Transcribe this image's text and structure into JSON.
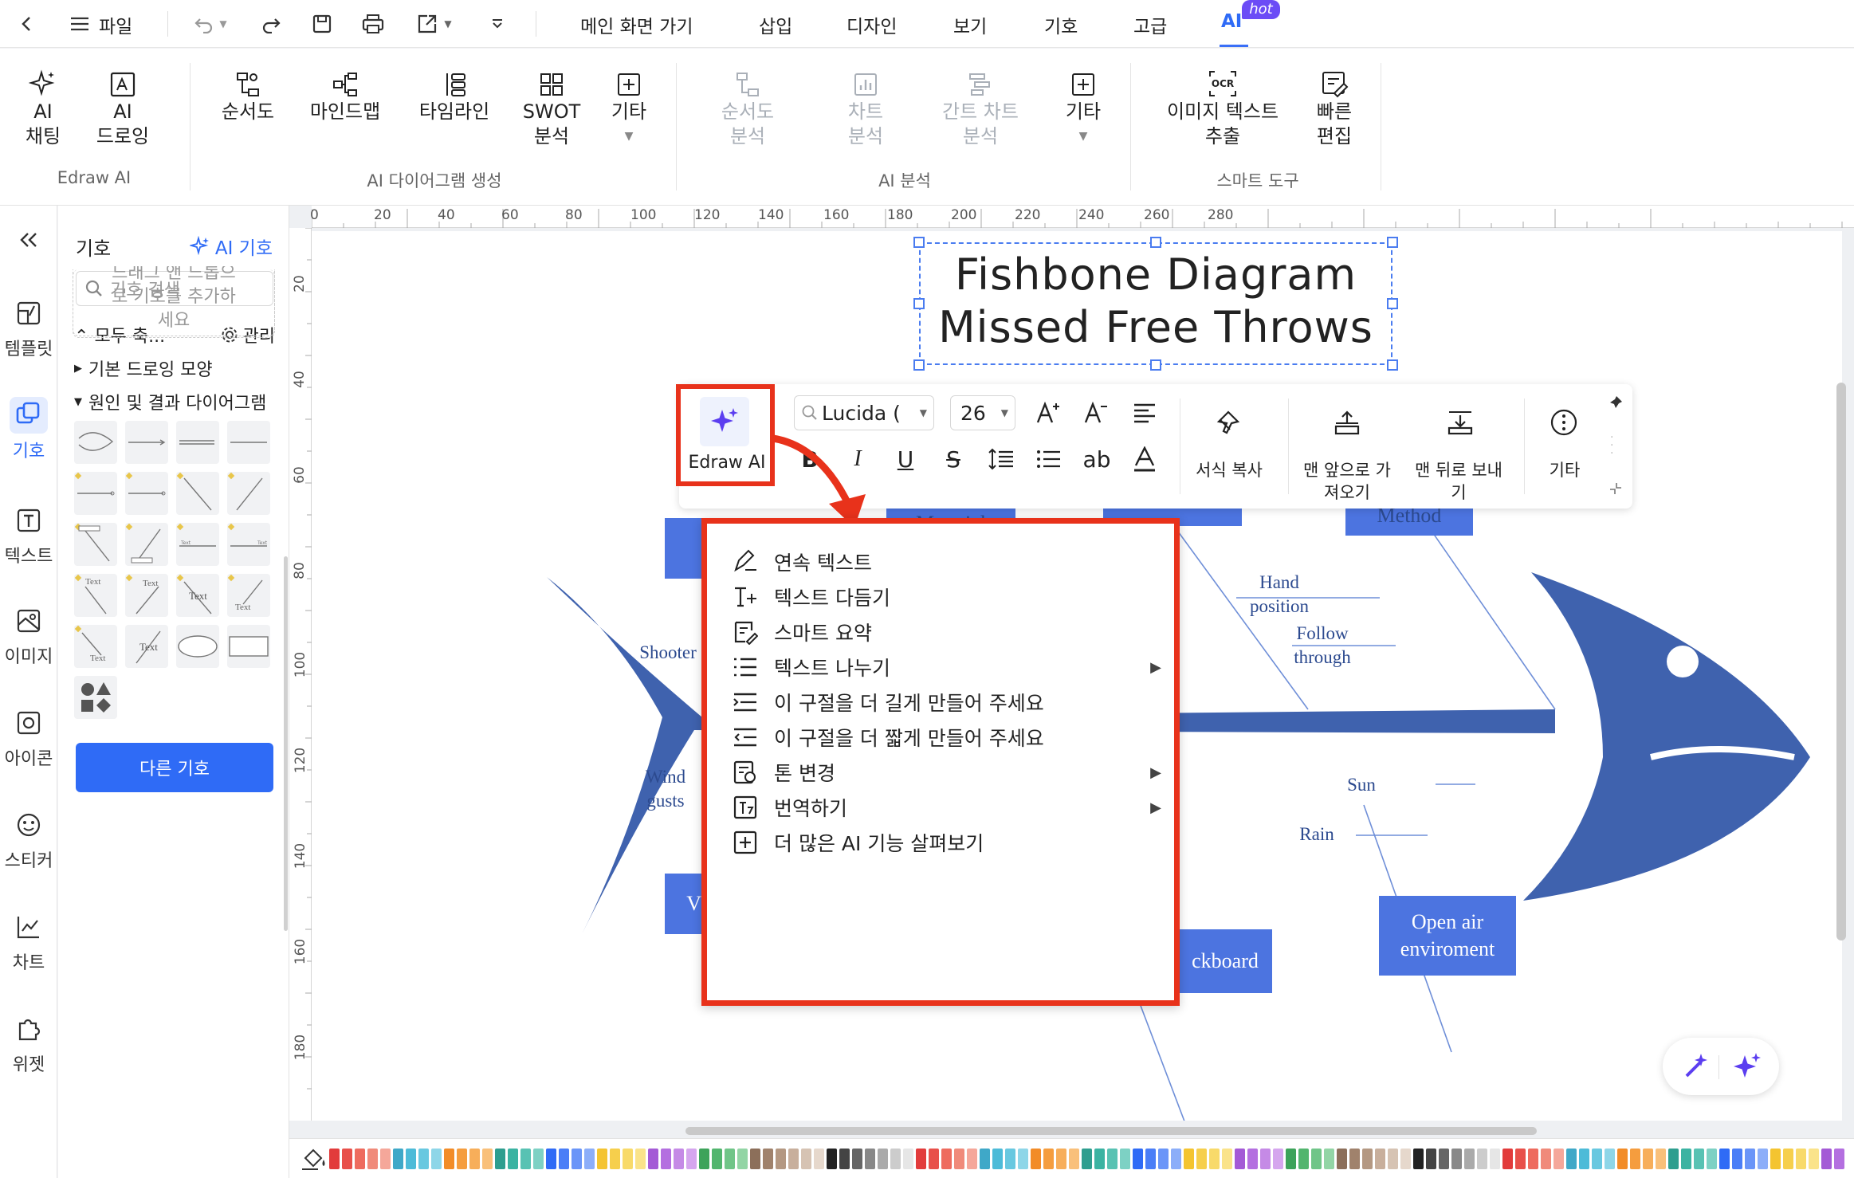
{
  "topbar": {
    "file_label": "파일",
    "menus": [
      {
        "label": "메인 화면 가기"
      },
      {
        "label": "삽입"
      },
      {
        "label": "디자인"
      },
      {
        "label": "보기"
      },
      {
        "label": "기호"
      },
      {
        "label": "고급"
      },
      {
        "label": "AI"
      }
    ],
    "hot_badge": "hot"
  },
  "ribbon": {
    "groups": [
      {
        "label": "Edraw AI"
      },
      {
        "label": "AI 다이어그램 생성"
      },
      {
        "label": "AI 분석"
      },
      {
        "label": "스마트 도구"
      }
    ],
    "buttons": [
      {
        "line1": "AI",
        "line2": "채팅"
      },
      {
        "line1": "AI",
        "line2": "드로잉"
      },
      {
        "line1": "순서도",
        "line2": ""
      },
      {
        "line1": "마인드맵",
        "line2": ""
      },
      {
        "line1": "타임라인",
        "line2": ""
      },
      {
        "line1": "SWOT",
        "line2": "분석"
      },
      {
        "line1": "기타",
        "line2": ""
      },
      {
        "line1": "순서도",
        "line2": "분석"
      },
      {
        "line1": "차트",
        "line2": "분석"
      },
      {
        "line1": "간트 차트",
        "line2": "분석"
      },
      {
        "line1": "기타",
        "line2": ""
      },
      {
        "line1": "이미지 텍스트",
        "line2": "추출"
      },
      {
        "line1": "빠른",
        "line2": "편집"
      }
    ]
  },
  "rail": {
    "items": [
      {
        "label": "템플릿"
      },
      {
        "label": "기호"
      },
      {
        "label": "텍스트"
      },
      {
        "label": "이미지"
      },
      {
        "label": "아이콘"
      },
      {
        "label": "스티커"
      },
      {
        "label": "차트"
      },
      {
        "label": "위젯"
      }
    ]
  },
  "panel": {
    "title": "기호",
    "ai_symbol": "AI 기호",
    "search_placeholder": "기호 검색",
    "collapse_all": "모두 축...",
    "manage": "관리",
    "drop_hint_1": "드래그 앤 드롭으",
    "drop_hint_2": "로 기호를 추가하",
    "drop_hint_3": "세요",
    "cat_basic": "기본 드로잉 모양",
    "cat_cause": "원인 및 결과 다이어그램",
    "other_symbols": "다른 기호",
    "shape_text": "Text"
  },
  "ruler": {
    "top": [
      "0",
      "20",
      "40",
      "60",
      "80",
      "100",
      "120",
      "140",
      "160",
      "180",
      "200",
      "220",
      "240",
      "260",
      "280"
    ],
    "left": [
      "20",
      "40",
      "60",
      "80",
      "100",
      "120",
      "140",
      "160",
      "180"
    ]
  },
  "diagram": {
    "title_line1": "Fishbone Diagram",
    "title_line2": "Missed Free Throws",
    "labels": {
      "shooter": "Shooter",
      "wind": "Wind",
      "gusts": "gusts",
      "hand": "Hand",
      "position": "position",
      "follow": "Follow",
      "through": "through",
      "sun": "Sun",
      "rain": "Rain",
      "material": "Material",
      "method": "Method",
      "blackboard": "ckboard",
      "open_air_1": "Open air",
      "open_air_2": "enviroment",
      "w_box": "V"
    }
  },
  "floatbar": {
    "edraw_ai": "Edraw AI",
    "font": "Lucida (",
    "size": "26",
    "format_copy": "서식 복사",
    "bring_front_1": "맨 앞으로 가",
    "bring_front_2": "져오기",
    "send_back_1": "맨 뒤로 보내",
    "send_back_2": "기",
    "more": "기타",
    "ab": "ab"
  },
  "ai_menu": {
    "items": [
      {
        "label": "연속 텍스트",
        "submenu": false
      },
      {
        "label": "텍스트 다듬기",
        "submenu": false
      },
      {
        "label": "스마트 요약",
        "submenu": false
      },
      {
        "label": "텍스트 나누기",
        "submenu": true
      },
      {
        "label": "이 구절을 더 길게 만들어 주세요",
        "submenu": false
      },
      {
        "label": "이 구절을 더 짧게 만들어 주세요",
        "submenu": false
      },
      {
        "label": "톤 변경",
        "submenu": true
      },
      {
        "label": "번역하기",
        "submenu": true
      },
      {
        "label": "더 많은 AI 기능 살펴보기",
        "submenu": false
      }
    ]
  },
  "colors": {
    "accent": "#2f6bf6",
    "fish": "#3f62ae",
    "box": "#4c74e0",
    "highlight": "#e8321b",
    "palette": [
      "#e23b3b",
      "#e8504a",
      "#ee6b5e",
      "#f08a7a",
      "#f5a79a",
      "#3fa8c8",
      "#4dbbd8",
      "#68c8e0",
      "#8ed6e8",
      "#f28c28",
      "#f59d3e",
      "#f7ae5a",
      "#f9c07a",
      "#2e9e8f",
      "#3bb3a2",
      "#58c2b3",
      "#7dd1c4",
      "#2f6bf6",
      "#4a7ef7",
      "#6a95f8",
      "#8caef9",
      "#f4c430",
      "#f6cf4c",
      "#f8da6a",
      "#faE38a",
      "#a45ad6",
      "#b46fe0",
      "#c58ae6",
      "#d5a6ee",
      "#3da35a",
      "#52b56e",
      "#70c588",
      "#92d5a5",
      "#8c6f5a",
      "#a0826c",
      "#b49882",
      "#c8af9c",
      "#d6c3b3",
      "#e6d8cc",
      "#222222",
      "#444444",
      "#666666",
      "#888888",
      "#aaaaaa",
      "#cccccc",
      "#e6e6e6"
    ]
  }
}
